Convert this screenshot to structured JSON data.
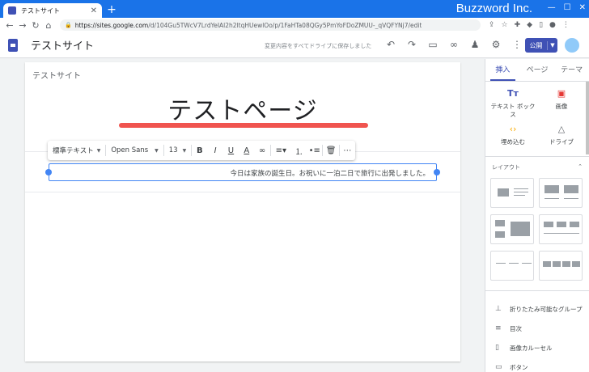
{
  "browser": {
    "tab_title": "テストサイト",
    "new_tab": "+",
    "url_host": "https://sites.google.com",
    "url_path": "/d/104Gu5TWcV7LrdYeIAl2h2ltqHUewlOo/p/1FaHTa08QGy5PmYoFDoZMUU-_qVQFYNj7/edit",
    "brand": "Buzzword Inc."
  },
  "app": {
    "site_name": "テストサイト",
    "save_status": "変更内容をすべてドライブに保存しました",
    "publish_label": "公開",
    "icons": [
      "undo-icon",
      "redo-icon",
      "preview-icon",
      "link-icon",
      "share-icon",
      "settings-icon",
      "more-icon"
    ]
  },
  "canvas": {
    "site_title": "テストサイト",
    "heading": "テストページ",
    "body_text": "今日は家族の誕生日。お祝いに一泊二日で旅行に出発しました。",
    "accent_color": "#f0544f"
  },
  "format_toolbar": {
    "style": "標準テキスト",
    "font": "Open Sans",
    "size": "13",
    "bold": "B",
    "italic": "I",
    "underline": "U",
    "text_color": "A"
  },
  "panel": {
    "tabs": [
      "挿入",
      "ページ",
      "テーマ"
    ],
    "active_tab": 0,
    "insert_items": [
      {
        "label": "テキスト ボックス",
        "icon": "Tт"
      },
      {
        "label": "画像",
        "icon": "▣"
      },
      {
        "label": "埋め込む",
        "icon": "‹›"
      },
      {
        "label": "ドライブ",
        "icon": "△"
      }
    ],
    "layout_header": "レイアウト",
    "list_items": [
      {
        "label": "折りたたみ可能なグループ",
        "icon": "⊥"
      },
      {
        "label": "目次",
        "icon": "≡"
      },
      {
        "label": "画像カルーセル",
        "icon": "▯"
      },
      {
        "label": "ボタン",
        "icon": "▭"
      }
    ]
  }
}
